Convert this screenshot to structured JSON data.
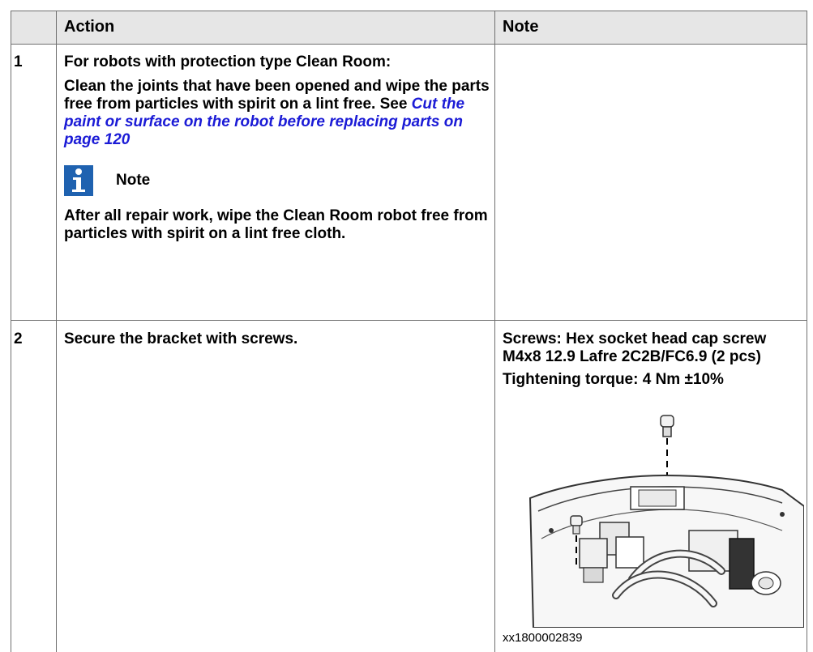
{
  "table": {
    "headers": [
      "Action",
      "Note"
    ],
    "rows": [
      {
        "step": "1",
        "action_title": "For robots with protection type Clean Room:",
        "action_text_before_link": "Clean the joints that have been opened and wipe the parts free from particles with spirit on a lint free. See ",
        "action_link": "Cut the paint or surface on the robot before replacing parts on page 120",
        "note_label": "Note",
        "note_text": "After all repair work, wipe the Clean Room robot free from particles with spirit on a lint free cloth.",
        "note": ""
      },
      {
        "step": "2",
        "action": "Secure the bracket with screws.",
        "note_screws": "Screws: Hex socket head cap screw M4x8 12.9 Lafre 2C2B/FC6.9 (2 pcs)",
        "note_torque": "Tightening torque: 4 Nm ±10%",
        "image_code": "xx1800002839"
      }
    ]
  },
  "colors": {
    "header_bg": "#e6e6e6",
    "link": "#1b1bd6",
    "note_icon_bg": "#1f62b0"
  },
  "icons": {
    "note": "info-icon"
  }
}
